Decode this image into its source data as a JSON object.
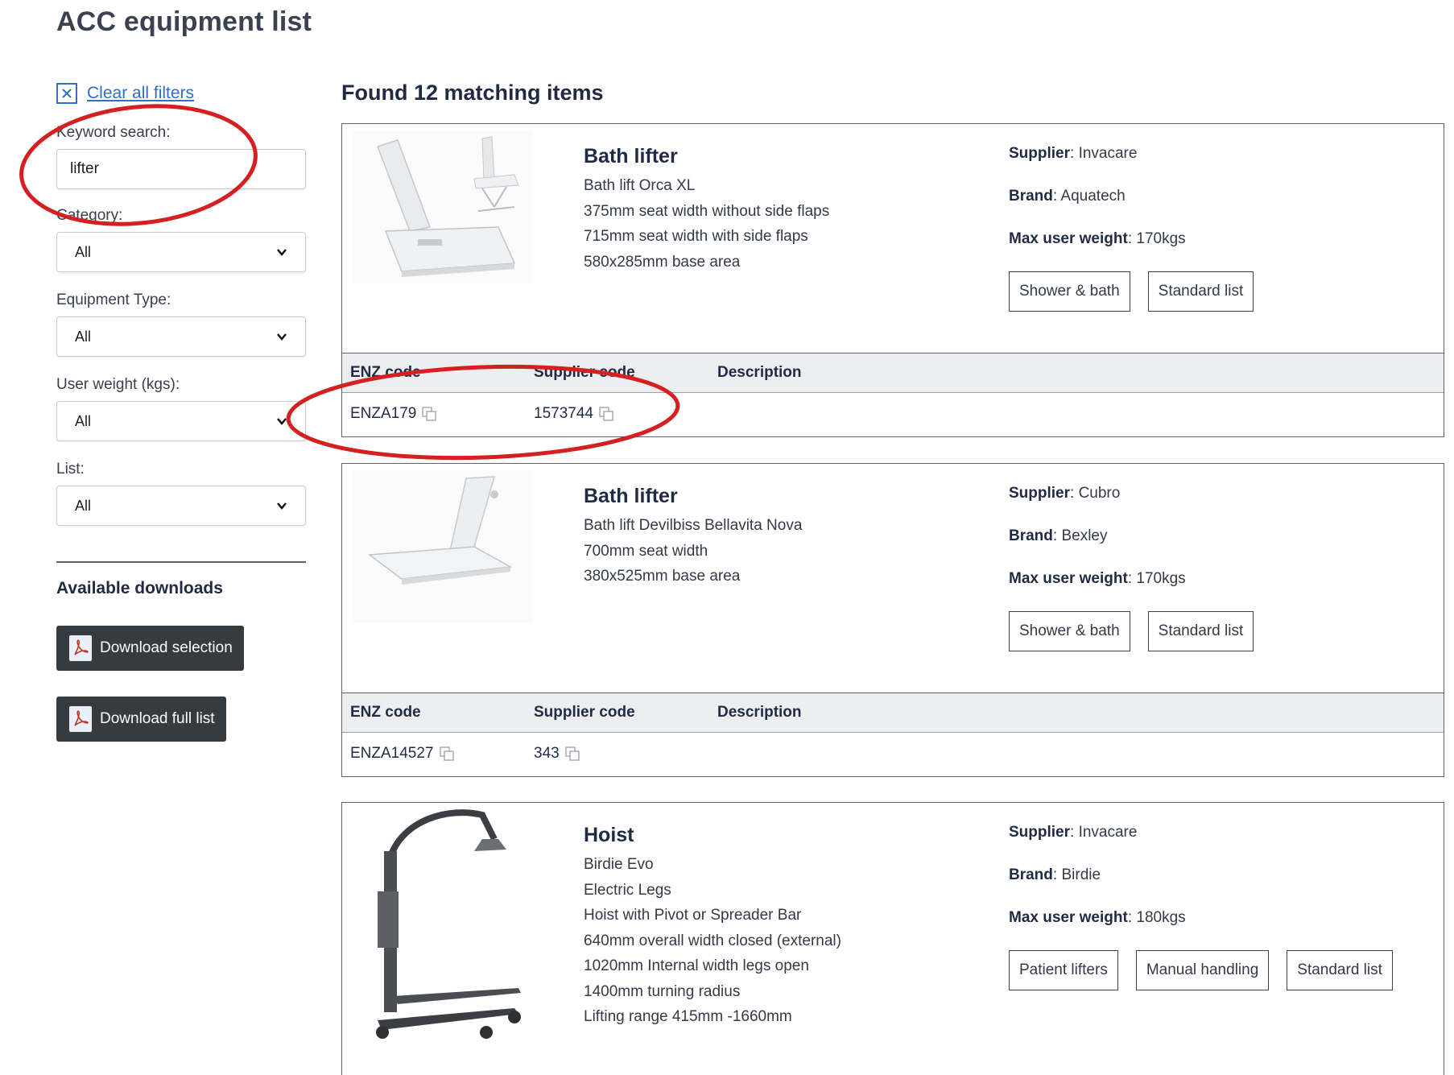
{
  "page_title": "ACC equipment list",
  "sidebar": {
    "clear_filters": "Clear all filters",
    "keyword_label": "Keyword search:",
    "keyword_value": "lifter",
    "category_label": "Category:",
    "category_value": "All",
    "equipment_type_label": "Equipment Type:",
    "equipment_type_value": "All",
    "user_weight_label": "User weight (kgs):",
    "user_weight_value": "All",
    "list_label": "List:",
    "list_value": "All",
    "downloads_title": "Available downloads",
    "download_selection": "Download selection",
    "download_full": "Download full list"
  },
  "results": {
    "found_text": "Found 12 matching items",
    "code_headers": {
      "enz": "ENZ code",
      "supplier": "Supplier code",
      "description": "Description"
    },
    "items": [
      {
        "name": "Bath lifter",
        "specs": [
          "Bath lift Orca XL",
          "375mm seat width without side flaps",
          "715mm seat width with side flaps",
          "580x285mm base area"
        ],
        "supplier_label": "Supplier",
        "supplier": "Invacare",
        "brand_label": "Brand",
        "brand": "Aquatech",
        "max_weight_label": "Max user weight",
        "max_weight": "170kgs",
        "tags": [
          "Shower & bath",
          "Standard list"
        ],
        "enz_code": "ENZA179",
        "supplier_code": "1573744"
      },
      {
        "name": "Bath lifter",
        "specs": [
          "Bath lift Devilbiss Bellavita Nova",
          "700mm seat width",
          "380x525mm base area"
        ],
        "supplier_label": "Supplier",
        "supplier": "Cubro",
        "brand_label": "Brand",
        "brand": "Bexley",
        "max_weight_label": "Max user weight",
        "max_weight": "170kgs",
        "tags": [
          "Shower & bath",
          "Standard list"
        ],
        "enz_code": "ENZA14527",
        "supplier_code": "343"
      },
      {
        "name": "Hoist",
        "specs": [
          "Birdie Evo",
          "Electric Legs",
          "Hoist with Pivot or Spreader Bar",
          "640mm overall width closed (external)",
          "1020mm Internal width legs open",
          "1400mm turning radius",
          "Lifting range 415mm -1660mm"
        ],
        "supplier_label": "Supplier",
        "supplier": "Invacare",
        "brand_label": "Brand",
        "brand": "Birdie",
        "max_weight_label": "Max user weight",
        "max_weight": "180kgs",
        "tags": [
          "Patient lifters",
          "Manual handling",
          "Standard list"
        ]
      }
    ]
  },
  "annotation_color": "#d42020"
}
